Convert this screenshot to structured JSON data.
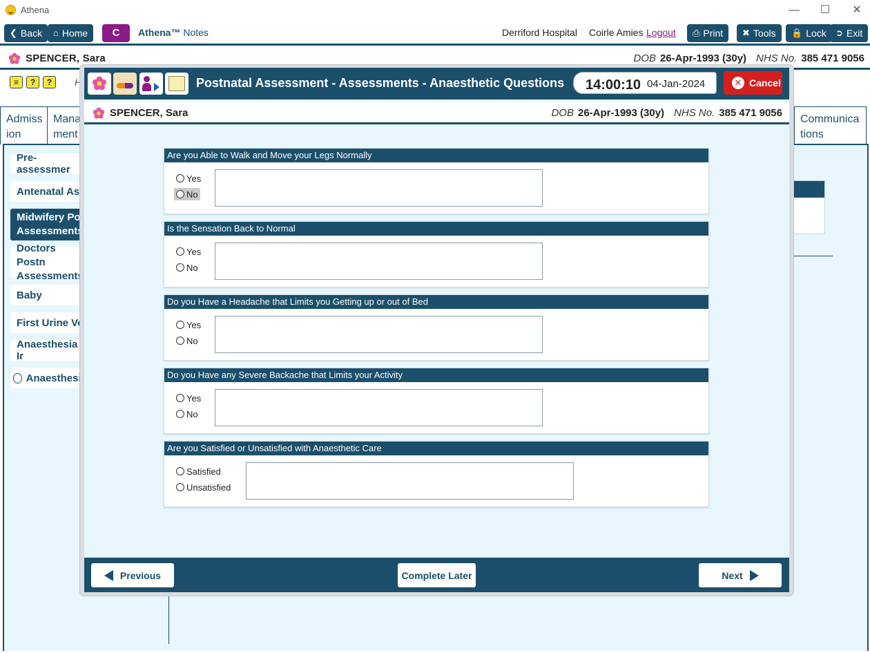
{
  "window": {
    "title": "Athena"
  },
  "toolbar": {
    "back": "Back",
    "home": "Home",
    "c_button": "C",
    "app_brand": "Athena™",
    "app_module": "Notes",
    "hospital": "Derriford Hospital",
    "user": "Coirle Amies",
    "logout": "Logout",
    "print": "Print",
    "tools": "Tools",
    "lock": "Lock",
    "exit": "Exit"
  },
  "patient": {
    "name": "SPENCER, Sara",
    "dob_label": "DOB",
    "dob": "26-Apr-1993 (30y)",
    "nhs_label": "NHS No.",
    "nhs": "385 471 9056"
  },
  "background": {
    "header_partial": "H",
    "tabs": [
      "Admiss ion",
      "Mana ment",
      "Communica tions"
    ],
    "side_items": [
      "Pre-assessmer",
      "Antenatal Ass",
      "Midwifery Pos Assessments",
      "Doctors Postn Assessments",
      "Baby",
      "First Urine Voi",
      "Anaesthesia Ir",
      "Anaesthesia"
    ]
  },
  "modal": {
    "title": "Postnatal Assessment - Assessments - Anaesthetic Questions",
    "time": "14:00:10",
    "date": "04-Jan-2024",
    "cancel": "Cancel",
    "questions": [
      {
        "label": "Are you Able to Walk and Move your Legs Normally",
        "options": [
          "Yes",
          "No"
        ],
        "selected": "No",
        "comment": ""
      },
      {
        "label": "Is the Sensation Back to Normal",
        "options": [
          "Yes",
          "No"
        ],
        "selected": null,
        "comment": ""
      },
      {
        "label": "Do you Have a Headache that Limits you Getting up or out of Bed",
        "options": [
          "Yes",
          "No"
        ],
        "selected": null,
        "comment": ""
      },
      {
        "label": "Do you Have any Severe Backache that Limits your Activity",
        "options": [
          "Yes",
          "No"
        ],
        "selected": null,
        "comment": ""
      },
      {
        "label": "Are you Satisfied or Unsatisfied with Anaesthetic Care",
        "options": [
          "Satisfied",
          "Unsatisfied"
        ],
        "selected": null,
        "comment": ""
      }
    ],
    "footer": {
      "previous": "Previous",
      "complete_later": "Complete Later",
      "next": "Next"
    }
  },
  "colors": {
    "primary": "#1b4f6b",
    "accent_purple": "#8b1a86",
    "cancel_red": "#d41f1f",
    "content_bg": "#e8f6fd"
  }
}
